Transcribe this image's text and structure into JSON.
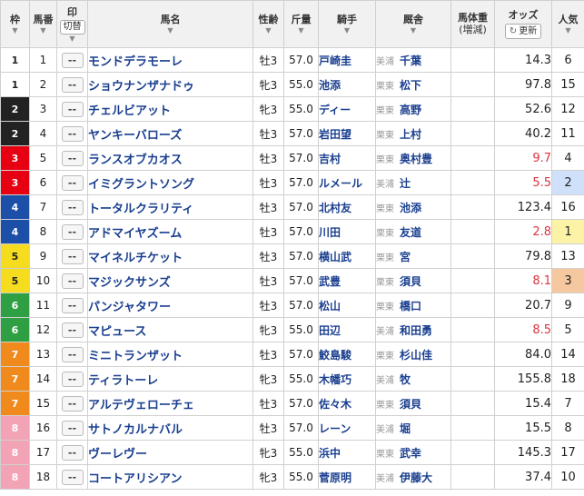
{
  "header": {
    "waku": "枠",
    "umaban": "馬番",
    "mark": "印",
    "mark_toggle": "切替",
    "horse": "馬名",
    "sexage": "性齢",
    "weight": "斤量",
    "jockey": "騎手",
    "stable": "厩舎",
    "body_weight": "馬体重",
    "body_weight_sub": "(増減)",
    "odds": "オッズ",
    "refresh": "更新",
    "popularity": "人気"
  },
  "mark_placeholder": "--",
  "colors": {
    "waku1": "#ffffff",
    "waku2": "#222222",
    "waku3": "#e60012",
    "waku4": "#1b4fa8",
    "waku5": "#f5dc1f",
    "waku6": "#2ea043",
    "waku7": "#f08a1c",
    "waku8": "#f2a3b5",
    "link": "#1a3f8f",
    "hot_odds": "#d9363e",
    "pop1": "#fdf3a6",
    "pop2": "#cfe1fa",
    "pop3": "#f5c8a0"
  },
  "rows": [
    {
      "waku": "1",
      "umaban": "1",
      "name": "モンドデラモーレ",
      "sexage": "牡3",
      "weight": "57.0",
      "jockey": "戸崎圭",
      "region": "美浦",
      "trainer": "千葉",
      "odds": "14.3",
      "pop": "6"
    },
    {
      "waku": "1",
      "umaban": "2",
      "name": "ショウナンザナドゥ",
      "sexage": "牝3",
      "weight": "55.0",
      "jockey": "池添",
      "region": "栗東",
      "trainer": "松下",
      "odds": "97.8",
      "pop": "15"
    },
    {
      "waku": "2",
      "umaban": "3",
      "name": "チェルビアット",
      "sexage": "牝3",
      "weight": "55.0",
      "jockey": "ディー",
      "region": "栗東",
      "trainer": "高野",
      "odds": "52.6",
      "pop": "12"
    },
    {
      "waku": "2",
      "umaban": "4",
      "name": "ヤンキーバローズ",
      "sexage": "牡3",
      "weight": "57.0",
      "jockey": "岩田望",
      "region": "栗東",
      "trainer": "上村",
      "odds": "40.2",
      "pop": "11"
    },
    {
      "waku": "3",
      "umaban": "5",
      "name": "ランスオブカオス",
      "sexage": "牡3",
      "weight": "57.0",
      "jockey": "吉村",
      "region": "栗東",
      "trainer": "奥村豊",
      "odds": "9.7",
      "pop": "4"
    },
    {
      "waku": "3",
      "umaban": "6",
      "name": "イミグラントソング",
      "sexage": "牡3",
      "weight": "57.0",
      "jockey": "ルメール",
      "region": "美浦",
      "trainer": "辻",
      "odds": "5.5",
      "pop": "2"
    },
    {
      "waku": "4",
      "umaban": "7",
      "name": "トータルクラリティ",
      "sexage": "牡3",
      "weight": "57.0",
      "jockey": "北村友",
      "region": "栗東",
      "trainer": "池添",
      "odds": "123.4",
      "pop": "16"
    },
    {
      "waku": "4",
      "umaban": "8",
      "name": "アドマイヤズーム",
      "sexage": "牡3",
      "weight": "57.0",
      "jockey": "川田",
      "region": "栗東",
      "trainer": "友道",
      "odds": "2.8",
      "pop": "1"
    },
    {
      "waku": "5",
      "umaban": "9",
      "name": "マイネルチケット",
      "sexage": "牡3",
      "weight": "57.0",
      "jockey": "横山武",
      "region": "栗東",
      "trainer": "宮",
      "odds": "79.8",
      "pop": "13"
    },
    {
      "waku": "5",
      "umaban": "10",
      "name": "マジックサンズ",
      "sexage": "牡3",
      "weight": "57.0",
      "jockey": "武豊",
      "region": "栗東",
      "trainer": "須貝",
      "odds": "8.1",
      "pop": "3"
    },
    {
      "waku": "6",
      "umaban": "11",
      "name": "パンジャタワー",
      "sexage": "牡3",
      "weight": "57.0",
      "jockey": "松山",
      "region": "栗東",
      "trainer": "橋口",
      "odds": "20.7",
      "pop": "9"
    },
    {
      "waku": "6",
      "umaban": "12",
      "name": "マピュース",
      "sexage": "牝3",
      "weight": "55.0",
      "jockey": "田辺",
      "region": "美浦",
      "trainer": "和田勇",
      "odds": "8.5",
      "pop": "5"
    },
    {
      "waku": "7",
      "umaban": "13",
      "name": "ミニトランザット",
      "sexage": "牡3",
      "weight": "57.0",
      "jockey": "鮫島駿",
      "region": "栗東",
      "trainer": "杉山佳",
      "odds": "84.0",
      "pop": "14"
    },
    {
      "waku": "7",
      "umaban": "14",
      "name": "ティラトーレ",
      "sexage": "牝3",
      "weight": "55.0",
      "jockey": "木幡巧",
      "region": "美浦",
      "trainer": "牧",
      "odds": "155.8",
      "pop": "18"
    },
    {
      "waku": "7",
      "umaban": "15",
      "name": "アルテヴェローチェ",
      "sexage": "牡3",
      "weight": "57.0",
      "jockey": "佐々木",
      "region": "栗東",
      "trainer": "須貝",
      "odds": "15.4",
      "pop": "7"
    },
    {
      "waku": "8",
      "umaban": "16",
      "name": "サトノカルナバル",
      "sexage": "牡3",
      "weight": "57.0",
      "jockey": "レーン",
      "region": "美浦",
      "trainer": "堀",
      "odds": "15.5",
      "pop": "8"
    },
    {
      "waku": "8",
      "umaban": "17",
      "name": "ヴーレヴー",
      "sexage": "牝3",
      "weight": "55.0",
      "jockey": "浜中",
      "region": "栗東",
      "trainer": "武幸",
      "odds": "145.3",
      "pop": "17"
    },
    {
      "waku": "8",
      "umaban": "18",
      "name": "コートアリシアン",
      "sexage": "牝3",
      "weight": "55.0",
      "jockey": "菅原明",
      "region": "美浦",
      "trainer": "伊藤大",
      "odds": "37.4",
      "pop": "10"
    }
  ]
}
